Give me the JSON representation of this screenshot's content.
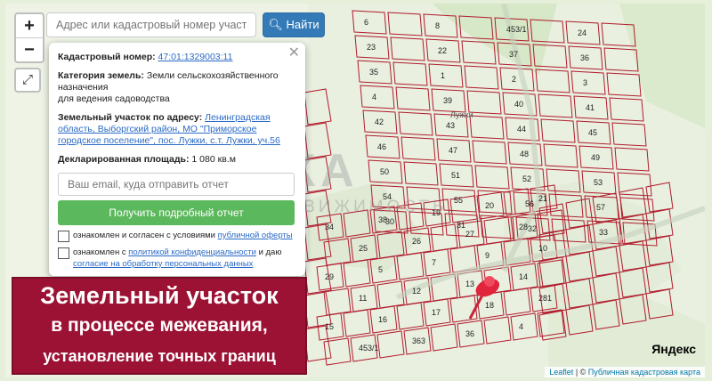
{
  "search": {
    "placeholder": "Адрес или кадастровый номер участка",
    "button": "Найти"
  },
  "zoom": {
    "in": "+",
    "out": "−"
  },
  "popup": {
    "cadastral_label": "Кадастровый номер:",
    "cadastral_value": "47:01:1329003:11",
    "category_label": "Категория земель:",
    "category_value": "Земли сельскохозяйственного назначения",
    "category_value2": "для ведения садоводства",
    "address_label": "Земельный участок по адресу:",
    "address_value": "Ленинградская область, Выборгский район, МО \"Приморское городское поселение\", пос. Лужки, с.т. Лужки, уч.56",
    "area_label": "Декларированная площадь:",
    "area_value": "1 080 кв.м",
    "email_placeholder": "Ваш email, куда отправить отчет",
    "report_button": "Получить подробный отчет",
    "terms_text": "ознакомлен и согласен с условиями",
    "terms_link": "публичной оферты",
    "privacy_text": "ознакомлен с",
    "privacy_link": "политикой конфиденциальности",
    "privacy_text2": "и даю",
    "consent_link": "согласие на обработку персональных данных"
  },
  "banner": {
    "line1": "Земельный участок",
    "line2": "в процессе межевания,",
    "line3": "установление точных границ"
  },
  "watermark": {
    "main": "ИТАКА",
    "sub": "НЕДВИЖИМОСТЬ"
  },
  "map_labels": [
    "6",
    "8",
    "453/1",
    "24",
    "23",
    "22",
    "37",
    "36",
    "35",
    "1",
    "2",
    "3",
    "4",
    "39",
    "40",
    "41",
    "42",
    "43",
    "44",
    "45",
    "46",
    "47",
    "48",
    "49",
    "50",
    "51",
    "52",
    "53",
    "54",
    "55",
    "56",
    "57",
    "30",
    "31",
    "32",
    "33",
    "34",
    "38",
    "19",
    "20",
    "21",
    "25",
    "26",
    "27",
    "28",
    "29",
    "5",
    "7",
    "9",
    "10",
    "11",
    "12",
    "13",
    "14",
    "15",
    "16",
    "17",
    "18",
    "281",
    "453/1",
    "363",
    "36",
    "4"
  ],
  "map_road_label": "Лужки",
  "yandex": "Яндекс",
  "attribution": {
    "leaflet": "Leaflet",
    "sep": " | © ",
    "source": "Публичная кадастровая карта"
  }
}
